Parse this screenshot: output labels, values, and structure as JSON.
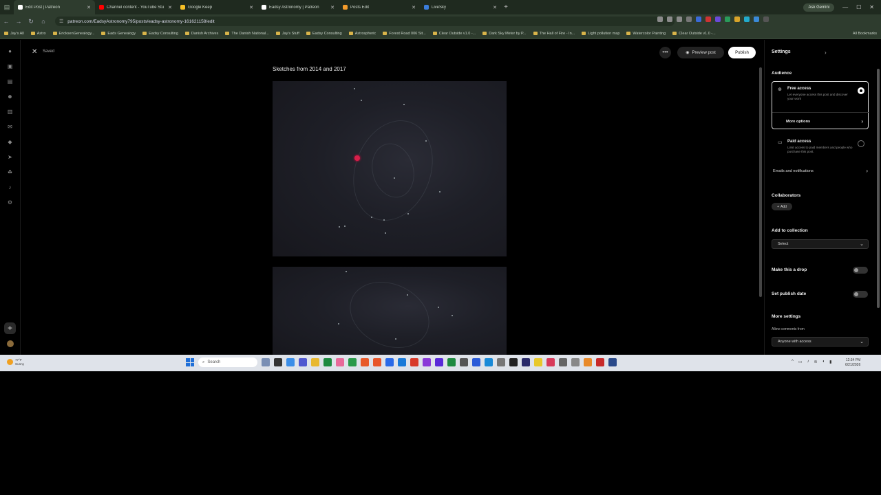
{
  "browser": {
    "tabs": [
      {
        "title": "Edit Post | Patreon",
        "color": "#ffffff",
        "active": true
      },
      {
        "title": "Channel content - YouTube Stu",
        "color": "#ff0000",
        "active": false
      },
      {
        "title": "Google Keep",
        "color": "#f6c026",
        "active": false
      },
      {
        "title": "Eadsy Astronomy | Patreon",
        "color": "#ffffff",
        "active": false
      },
      {
        "title": "Posts Edit",
        "color": "#f39b2b",
        "active": false
      },
      {
        "title": "LiveSky",
        "color": "#3b7ddb",
        "active": false
      }
    ],
    "ask_gemini": "Ask Gemini",
    "url": "patreon.com/EadsyAstronomy795/posts/eadsy-astronomy-161621158/edit",
    "bookmarks": [
      "Jay's All",
      "Astro",
      "EricksenGenealogy...",
      "Eads Genealogy",
      "Eadsy Consulting",
      "Danish Archives",
      "The Danish National...",
      "Jay's Stuff",
      "Eadsy Consulting",
      "Astrospheric",
      "Forest Road 006 Sit...",
      "Clear Outside v1.0 -...",
      "Dark Sky Meter by P...",
      "The Hall of Fire - In...",
      "Light pollution map",
      "Watercolor Painting",
      "Clear Outside v1.0 -..."
    ],
    "all_bookmarks": "All Bookmarks"
  },
  "editor": {
    "saved": "Saved",
    "post_title": "Sketches from 2014 and 2017",
    "preview_label": "Preview post",
    "publish_label": "Publish"
  },
  "settings": {
    "heading": "Settings",
    "audience_label": "Audience",
    "free_access": {
      "title": "Free access",
      "desc": "Let everyone access this post and discover your work",
      "selected": true
    },
    "more_options": "More options",
    "paid_access": {
      "title": "Paid access",
      "desc": "Limit access to paid members and people who purchase this post.",
      "selected": false
    },
    "emails_notifications": "Emails and notifications",
    "collaborators_label": "Collaborators",
    "add_label": "Add",
    "add_to_collection_label": "Add to collection",
    "collection_select": "Select",
    "make_drop_label": "Make this a drop",
    "make_drop_on": false,
    "publish_date_label": "Set publish date",
    "publish_date_on": false,
    "more_settings_label": "More settings",
    "allow_comments_label": "Allow comments from",
    "allow_comments_value": "Anyone with access"
  },
  "taskbar": {
    "weather_temp": "77°F",
    "weather_desc": "Sunny",
    "search_placeholder": "Search",
    "time": "12:34 PM",
    "date": "6/21/2026"
  }
}
